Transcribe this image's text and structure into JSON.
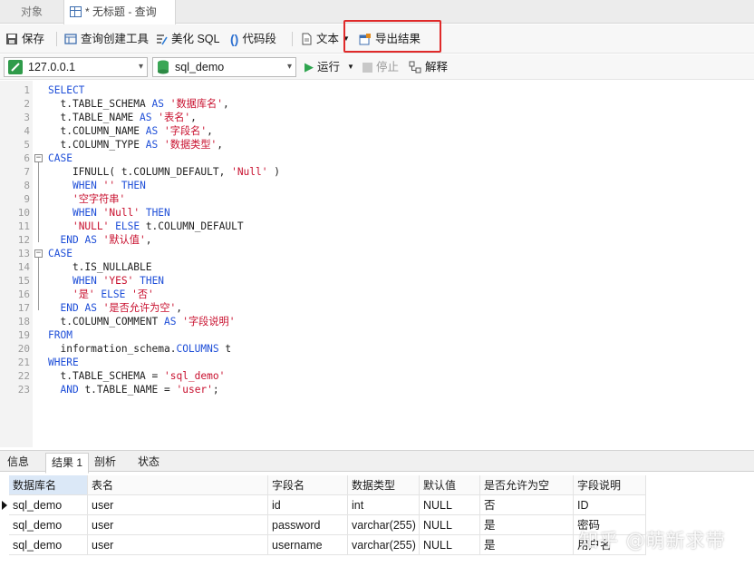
{
  "tabs": {
    "objects": "对象",
    "query": "* 无标题 - 查询"
  },
  "toolbar": {
    "save": "保存",
    "query_builder": "查询创建工具",
    "beautify": "美化 SQL",
    "snippet": "代码段",
    "text": "文本",
    "export": "导出结果"
  },
  "connection": {
    "host": "127.0.0.1",
    "database": "sql_demo",
    "run": "运行",
    "stop": "停止",
    "explain": "解释"
  },
  "editor": {
    "lines": [
      [
        [
          "kw",
          "SELECT"
        ]
      ],
      [
        [
          "pl",
          "  t.TABLE_SCHEMA "
        ],
        [
          "kw",
          "AS"
        ],
        [
          "pl",
          " "
        ],
        [
          "str",
          "'数据库名'"
        ],
        [
          "pl",
          ","
        ]
      ],
      [
        [
          "pl",
          "  t.TABLE_NAME "
        ],
        [
          "kw",
          "AS"
        ],
        [
          "pl",
          " "
        ],
        [
          "str",
          "'表名'"
        ],
        [
          "pl",
          ","
        ]
      ],
      [
        [
          "pl",
          "  t.COLUMN_NAME "
        ],
        [
          "kw",
          "AS"
        ],
        [
          "pl",
          " "
        ],
        [
          "str",
          "'字段名'"
        ],
        [
          "pl",
          ","
        ]
      ],
      [
        [
          "pl",
          "  t.COLUMN_TYPE "
        ],
        [
          "kw",
          "AS"
        ],
        [
          "pl",
          " "
        ],
        [
          "str",
          "'数据类型'"
        ],
        [
          "pl",
          ","
        ]
      ],
      [
        [
          "kw",
          "CASE"
        ]
      ],
      [
        [
          "pl",
          "    IFNULL( t.COLUMN_DEFAULT, "
        ],
        [
          "str",
          "'Null'"
        ],
        [
          "pl",
          " )"
        ]
      ],
      [
        [
          "pl",
          "    "
        ],
        [
          "kw",
          "WHEN"
        ],
        [
          "pl",
          " "
        ],
        [
          "str",
          "''"
        ],
        [
          "pl",
          " "
        ],
        [
          "kw",
          "THEN"
        ]
      ],
      [
        [
          "pl",
          "    "
        ],
        [
          "str",
          "'空字符串'"
        ]
      ],
      [
        [
          "pl",
          "    "
        ],
        [
          "kw",
          "WHEN"
        ],
        [
          "pl",
          " "
        ],
        [
          "str",
          "'Null'"
        ],
        [
          "pl",
          " "
        ],
        [
          "kw",
          "THEN"
        ]
      ],
      [
        [
          "pl",
          "    "
        ],
        [
          "str",
          "'NULL'"
        ],
        [
          "pl",
          " "
        ],
        [
          "kw",
          "ELSE"
        ],
        [
          "pl",
          " t.COLUMN_DEFAULT"
        ]
      ],
      [
        [
          "pl",
          "  "
        ],
        [
          "kw",
          "END"
        ],
        [
          "pl",
          " "
        ],
        [
          "kw",
          "AS"
        ],
        [
          "pl",
          " "
        ],
        [
          "str",
          "'默认值'"
        ],
        [
          "pl",
          ","
        ]
      ],
      [
        [
          "kw",
          "CASE"
        ]
      ],
      [
        [
          "pl",
          "    t.IS_NULLABLE"
        ]
      ],
      [
        [
          "pl",
          "    "
        ],
        [
          "kw",
          "WHEN"
        ],
        [
          "pl",
          " "
        ],
        [
          "str",
          "'YES'"
        ],
        [
          "pl",
          " "
        ],
        [
          "kw",
          "THEN"
        ]
      ],
      [
        [
          "pl",
          "    "
        ],
        [
          "str",
          "'是'"
        ],
        [
          "pl",
          " "
        ],
        [
          "kw",
          "ELSE"
        ],
        [
          "pl",
          " "
        ],
        [
          "str",
          "'否'"
        ]
      ],
      [
        [
          "pl",
          "  "
        ],
        [
          "kw",
          "END"
        ],
        [
          "pl",
          " "
        ],
        [
          "kw",
          "AS"
        ],
        [
          "pl",
          " "
        ],
        [
          "str",
          "'是否允许为空'"
        ],
        [
          "pl",
          ","
        ]
      ],
      [
        [
          "pl",
          "  t.COLUMN_COMMENT "
        ],
        [
          "kw",
          "AS"
        ],
        [
          "pl",
          " "
        ],
        [
          "str",
          "'字段说明'"
        ]
      ],
      [
        [
          "kw",
          "FROM"
        ]
      ],
      [
        [
          "pl",
          "  information_schema."
        ],
        [
          "kw",
          "COLUMNS"
        ],
        [
          "pl",
          " t"
        ]
      ],
      [
        [
          "kw",
          "WHERE"
        ]
      ],
      [
        [
          "pl",
          "  t.TABLE_SCHEMA = "
        ],
        [
          "str",
          "'sql_demo'"
        ]
      ],
      [
        [
          "pl",
          "  "
        ],
        [
          "kw",
          "AND"
        ],
        [
          "pl",
          " t.TABLE_NAME = "
        ],
        [
          "str",
          "'user'"
        ],
        [
          "pl",
          ";"
        ]
      ]
    ]
  },
  "result_tabs": [
    "信息",
    "结果 1",
    "剖析",
    "状态"
  ],
  "results": {
    "columns": [
      "数据库名",
      "表名",
      "字段名",
      "数据类型",
      "默认值",
      "是否允许为空",
      "字段说明"
    ],
    "rows": [
      [
        "sql_demo",
        "user",
        "id",
        "int",
        "NULL",
        "否",
        "ID"
      ],
      [
        "sql_demo",
        "user",
        "password",
        "varchar(255)",
        "NULL",
        "是",
        "密码"
      ],
      [
        "sql_demo",
        "user",
        "username",
        "varchar(255)",
        "NULL",
        "是",
        "用户名"
      ]
    ]
  },
  "watermark": "知乎 @萌新求带",
  "colors": {
    "keyword": "#1f4fd8",
    "string": "#c8102e",
    "highlight_box": "#e02a2a",
    "run_icon": "#2da44e"
  }
}
